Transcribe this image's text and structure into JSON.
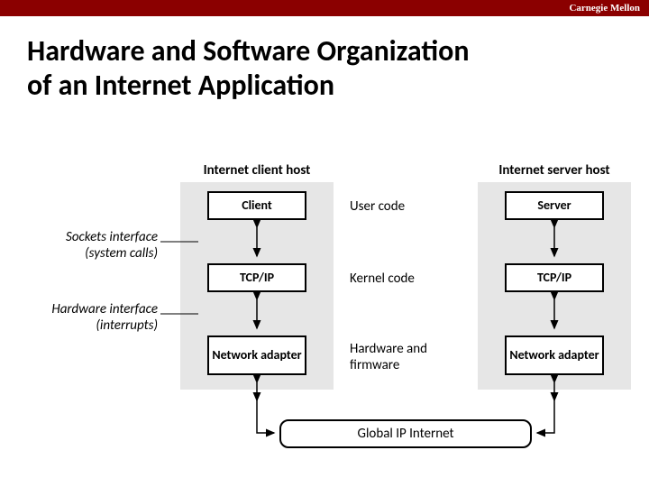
{
  "brand": "Carnegie Mellon",
  "title_line1": "Hardware and Software Organization",
  "title_line2": "of an Internet Application",
  "client_host_label": "Internet client host",
  "server_host_label": "Internet server host",
  "client": {
    "app": "Client",
    "transport": "TCP/IP",
    "nic": "Network adapter"
  },
  "server": {
    "app": "Server",
    "transport": "TCP/IP",
    "nic": "Network adapter"
  },
  "layers": {
    "user": "User code",
    "kernel": "Kernel code",
    "hw": "Hardware and firmware"
  },
  "side": {
    "sockets1": "Sockets interface",
    "sockets2": "(system calls)",
    "hw1": "Hardware interface",
    "hw2": "(interrupts)"
  },
  "global": "Global IP Internet"
}
